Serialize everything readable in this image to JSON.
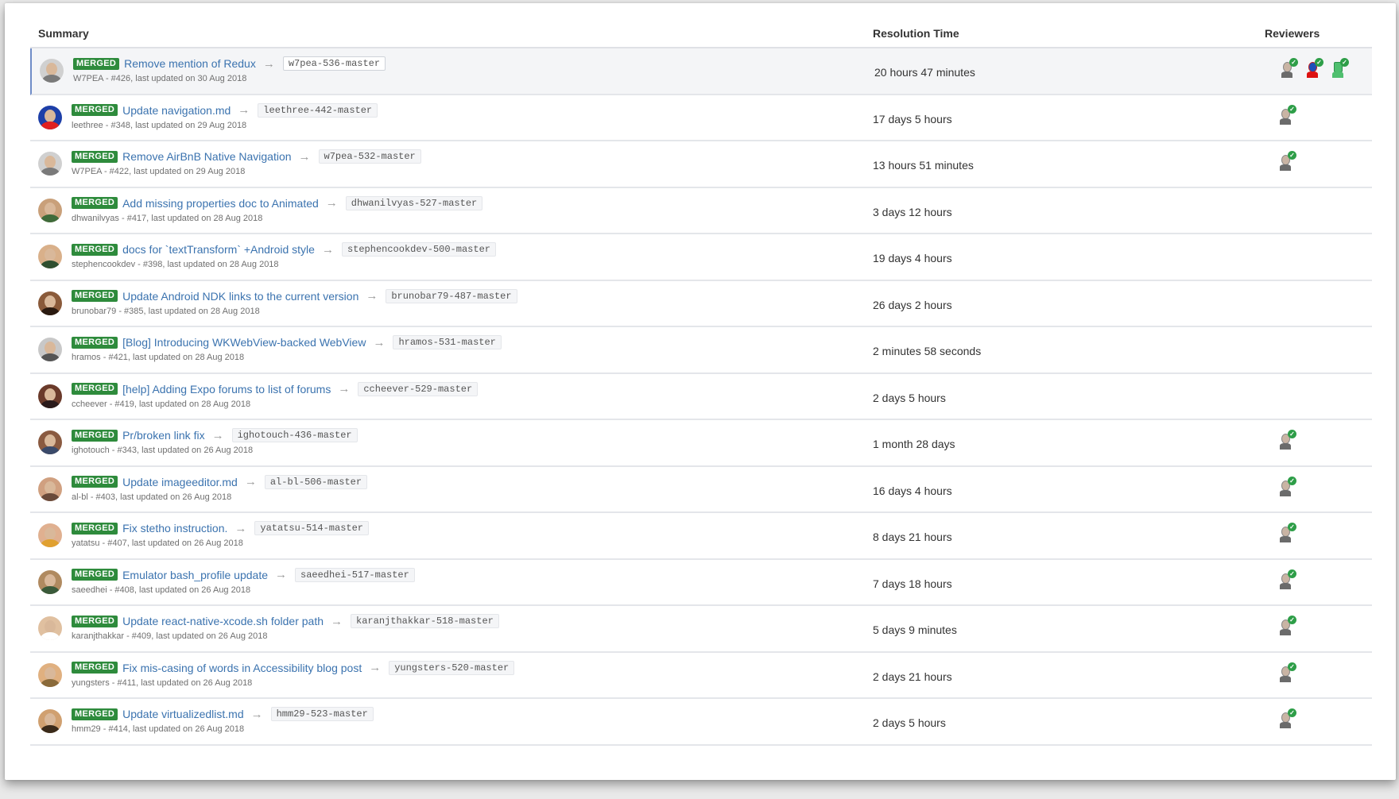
{
  "header": {
    "summary": "Summary",
    "resolution_time": "Resolution Time",
    "reviewers": "Reviewers"
  },
  "colors": {
    "merged_badge": "#2e8b3c",
    "link": "#3b73af",
    "approved_check": "#2e9e48"
  },
  "icons": {
    "arrow": "arrow-right-icon",
    "approved": "check-circle-icon"
  },
  "rows": [
    {
      "badge": "MERGED",
      "title": "Remove mention of Redux",
      "branch": "w7pea-536-master",
      "meta": "W7PEA - #426, last updated on 30 Aug 2018",
      "resolution": "20 hours 47 minutes",
      "reviewers": 3
    },
    {
      "badge": "MERGED",
      "title": "Update navigation.md",
      "branch": "leethree-442-master",
      "meta": "leethree - #348, last updated on 29 Aug 2018",
      "resolution": "17 days 5 hours",
      "reviewers": 1
    },
    {
      "badge": "MERGED",
      "title": "Remove AirBnB Native Navigation",
      "branch": "w7pea-532-master",
      "meta": "W7PEA - #422, last updated on 29 Aug 2018",
      "resolution": "13 hours 51 minutes",
      "reviewers": 1
    },
    {
      "badge": "MERGED",
      "title": "Add missing properties doc to Animated",
      "branch": "dhwanilvyas-527-master",
      "meta": "dhwanilvyas - #417, last updated on 28 Aug 2018",
      "resolution": "3 days 12 hours",
      "reviewers": 0
    },
    {
      "badge": "MERGED",
      "title": "docs for `textTransform` +Android style",
      "branch": "stephencookdev-500-master",
      "meta": "stephencookdev - #398, last updated on 28 Aug 2018",
      "resolution": "19 days 4 hours",
      "reviewers": 0
    },
    {
      "badge": "MERGED",
      "title": "Update Android NDK links to the current version",
      "branch": "brunobar79-487-master",
      "meta": "brunobar79 - #385, last updated on 28 Aug 2018",
      "resolution": "26 days 2 hours",
      "reviewers": 0
    },
    {
      "badge": "MERGED",
      "title": "[Blog] Introducing WKWebView-backed WebView",
      "branch": "hramos-531-master",
      "meta": "hramos - #421, last updated on 28 Aug 2018",
      "resolution": "2 minutes 58 seconds",
      "reviewers": 0
    },
    {
      "badge": "MERGED",
      "title": "[help] Adding Expo forums to list of forums",
      "branch": "ccheever-529-master",
      "meta": "ccheever - #419, last updated on 28 Aug 2018",
      "resolution": "2 days 5 hours",
      "reviewers": 0
    },
    {
      "badge": "MERGED",
      "title": "Pr/broken link fix",
      "branch": "ighotouch-436-master",
      "meta": "ighotouch - #343, last updated on 26 Aug 2018",
      "resolution": "1 month 28 days",
      "reviewers": 1
    },
    {
      "badge": "MERGED",
      "title": "Update imageeditor.md",
      "branch": "al-bl-506-master",
      "meta": "al-bl - #403, last updated on 26 Aug 2018",
      "resolution": "16 days 4 hours",
      "reviewers": 1
    },
    {
      "badge": "MERGED",
      "title": "Fix stetho instruction.",
      "branch": "yatatsu-514-master",
      "meta": "yatatsu - #407, last updated on 26 Aug 2018",
      "resolution": "8 days 21 hours",
      "reviewers": 1
    },
    {
      "badge": "MERGED",
      "title": "Emulator bash_profile update",
      "branch": "saeedhei-517-master",
      "meta": "saeedhei - #408, last updated on 26 Aug 2018",
      "resolution": "7 days 18 hours",
      "reviewers": 1
    },
    {
      "badge": "MERGED",
      "title": "Update react-native-xcode.sh folder path",
      "branch": "karanjthakkar-518-master",
      "meta": "karanjthakkar - #409, last updated on 26 Aug 2018",
      "resolution": "5 days 9 minutes",
      "reviewers": 1
    },
    {
      "badge": "MERGED",
      "title": "Fix mis-casing of words in Accessibility blog post",
      "branch": "yungsters-520-master",
      "meta": "yungsters - #411, last updated on 26 Aug 2018",
      "resolution": "2 days 21 hours",
      "reviewers": 1
    },
    {
      "badge": "MERGED",
      "title": "Update virtualizedlist.md",
      "branch": "hmm29-523-master",
      "meta": "hmm29 - #414, last updated on 26 Aug 2018",
      "resolution": "2 days 5 hours",
      "reviewers": 1
    }
  ]
}
